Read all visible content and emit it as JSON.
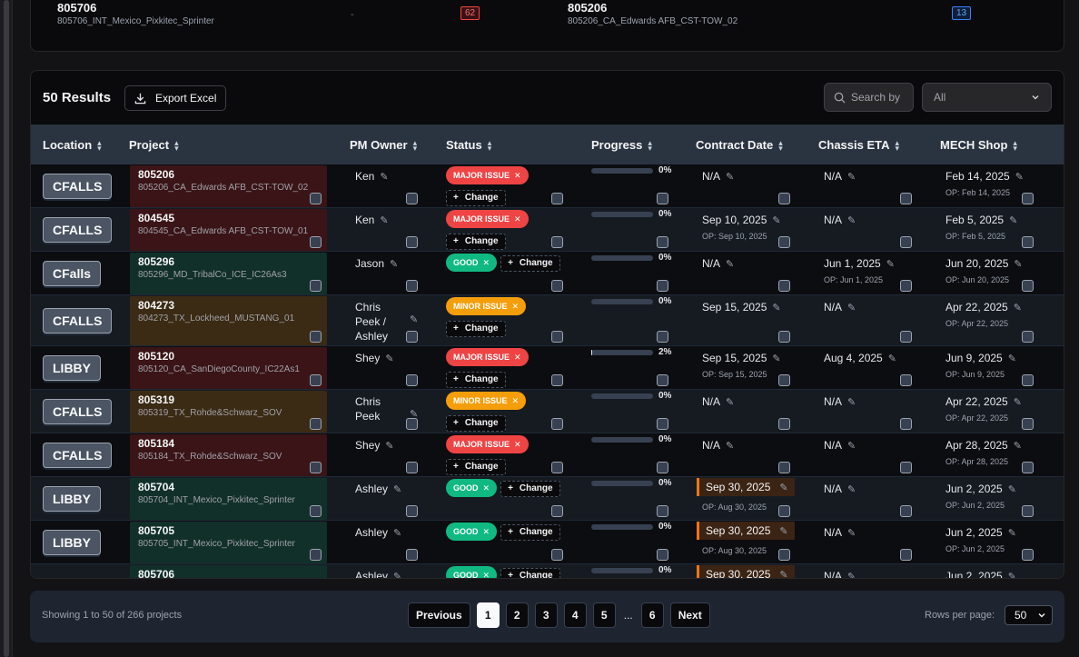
{
  "top_row": {
    "left_id": "805706",
    "left_name": "805706_INT_Mexico_Pixkitec_Sprinter",
    "dash": "-",
    "left_badge": "62",
    "right_id": "805206",
    "right_name": "805206_CA_Edwards AFB_CST-TOW_02",
    "right_badge": "13"
  },
  "toolbar": {
    "results": "50 Results",
    "export_label": "Export Excel",
    "search_label": "Search by",
    "filter_value": "All"
  },
  "columns": {
    "location": "Location",
    "project": "Project",
    "pm_owner": "PM Owner",
    "status": "Status",
    "progress": "Progress",
    "contract_date": "Contract Date",
    "chassis_eta": "Chassis ETA",
    "mech_shop": "MECH Shop"
  },
  "change_label": "Change",
  "rows": [
    {
      "location": "CFALLS",
      "id": "805206",
      "name": "805206_CA_Edwards AFB_CST-TOW_02",
      "owner": "Ken",
      "status": "MAJOR ISSUE",
      "progress": "0%",
      "contract": "N/A",
      "contract_op": "",
      "chassis": "N/A",
      "chassis_op": "",
      "mech": "Feb 14, 2025",
      "mech_op": "OP: Feb 14, 2025"
    },
    {
      "location": "CFALLS",
      "id": "804545",
      "name": "804545_CA_Edwards AFB_CST-TOW_01",
      "owner": "Ken",
      "status": "MAJOR ISSUE",
      "progress": "0%",
      "contract": "Sep 10, 2025",
      "contract_op": "OP: Sep 10, 2025",
      "chassis": "N/A",
      "chassis_op": "",
      "mech": "Feb 5, 2025",
      "mech_op": "OP: Feb 5, 2025"
    },
    {
      "location": "CFalls",
      "id": "805296",
      "name": "805296_MD_TribalCo_ICE_IC26As3",
      "owner": "Jason",
      "status": "GOOD",
      "progress": "0%",
      "contract": "N/A",
      "contract_op": "",
      "chassis": "Jun 1, 2025",
      "chassis_op": "OP: Jun 1, 2025",
      "mech": "Jun 20, 2025",
      "mech_op": "OP: Jun 20, 2025"
    },
    {
      "location": "CFALLS",
      "id": "804273",
      "name": "804273_TX_Lockheed_MUSTANG_01",
      "owner_lines": [
        "Chris",
        "Peek /",
        "Ashley"
      ],
      "status": "MINOR ISSUE",
      "progress": "0%",
      "contract": "Sep 15, 2025",
      "contract_op": "",
      "chassis": "N/A",
      "chassis_op": "",
      "mech": "Apr 22, 2025",
      "mech_op": "OP: Apr 22, 2025"
    },
    {
      "location": "LIBBY",
      "id": "805120",
      "name": "805120_CA_SanDiegoCounty_IC22As1",
      "owner": "Shey",
      "status": "MAJOR ISSUE",
      "progress": "2%",
      "contract": "Sep 15, 2025",
      "contract_op": "OP: Sep 15, 2025",
      "chassis": "Aug 4, 2025",
      "chassis_op": "",
      "mech": "Jun 9, 2025",
      "mech_op": "OP: Jun 9, 2025"
    },
    {
      "location": "CFALLS",
      "id": "805319",
      "name": "805319_TX_Rohde&Schwarz_SOV",
      "owner_lines": [
        "Chris",
        "Peek"
      ],
      "status": "MINOR ISSUE",
      "progress": "0%",
      "contract": "N/A",
      "contract_op": "",
      "chassis": "N/A",
      "chassis_op": "",
      "mech": "Apr 22, 2025",
      "mech_op": "OP: Apr 22, 2025"
    },
    {
      "location": "CFALLS",
      "id": "805184",
      "name": "805184_TX_Rohde&Schwarz_SOV",
      "owner": "Shey",
      "status": "MAJOR ISSUE",
      "progress": "0%",
      "contract": "N/A",
      "contract_op": "",
      "chassis": "N/A",
      "chassis_op": "",
      "mech": "Apr 28, 2025",
      "mech_op": "OP: Apr 28, 2025"
    },
    {
      "location": "LIBBY",
      "id": "805704",
      "name": "805704_INT_Mexico_Pixkitec_Sprinter",
      "owner": "Ashley",
      "status": "GOOD",
      "progress": "0%",
      "contract": "Sep 30, 2025",
      "contract_op": "OP: Aug 30, 2025",
      "chassis": "N/A",
      "chassis_op": "",
      "mech": "Jun 2, 2025",
      "mech_op": "OP: Jun 2, 2025"
    },
    {
      "location": "LIBBY",
      "id": "805705",
      "name": "805705_INT_Mexico_Pixkitec_Sprinter",
      "owner": "Ashley",
      "status": "GOOD",
      "progress": "0%",
      "contract": "Sep 30, 2025",
      "contract_op": "OP: Aug 30, 2025",
      "chassis": "N/A",
      "chassis_op": "",
      "mech": "Jun 2, 2025",
      "mech_op": "OP: Jun 2, 2025"
    },
    {
      "location": "",
      "id": "805706",
      "name": "",
      "owner": "Ashley",
      "status": "GOOD",
      "progress": "0%",
      "contract": "Sep 30, 2025",
      "contract_op": "",
      "chassis": "N/A",
      "chassis_op": "",
      "mech": "Jun 2, 2025",
      "mech_op": ""
    }
  ],
  "footer": {
    "showing": "Showing 1 to 50 of 266 projects",
    "previous": "Previous",
    "next": "Next",
    "pages": [
      "1",
      "2",
      "3",
      "4",
      "5"
    ],
    "ellipsis": "...",
    "last_page": "6",
    "rows_per_page_label": "Rows per page:",
    "rows_per_page_value": "50"
  },
  "colors": {
    "major": "#ef4444",
    "minor": "#f59e0b",
    "good": "#10b981",
    "contract_highlight": "#f97316",
    "header_bg": "#2a3441"
  }
}
